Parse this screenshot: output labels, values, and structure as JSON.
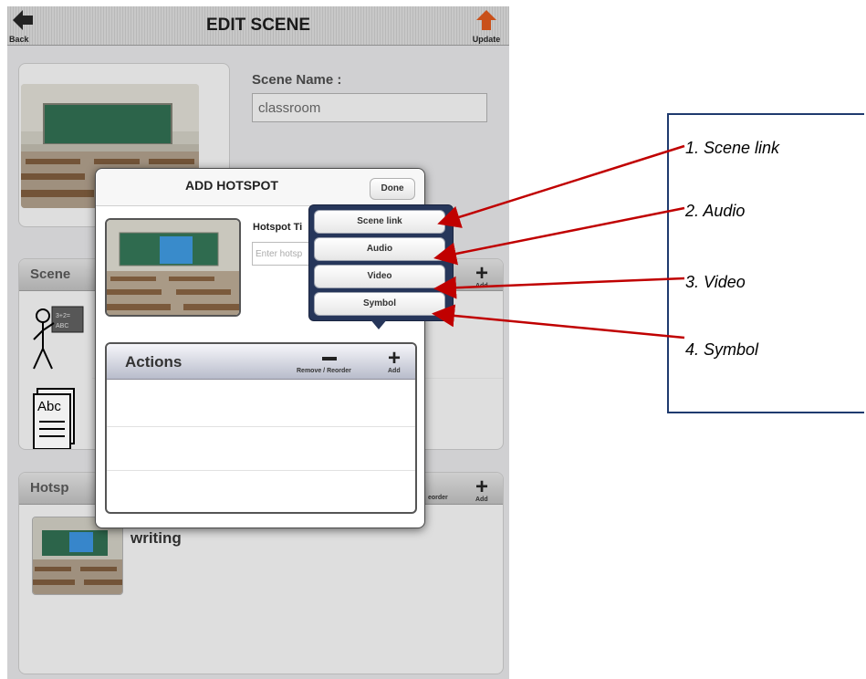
{
  "header": {
    "title": "EDIT SCENE",
    "back_label": "Back",
    "update_label": "Update"
  },
  "scene": {
    "name_label": "Scene Name :",
    "name_value": "classroom"
  },
  "scenes_section": {
    "title": "Scene",
    "add_label": "Add"
  },
  "hotspots_section": {
    "title": "Hotsp",
    "reorder_label": "eorder",
    "add_label": "Add",
    "items": [
      {
        "title": "writing"
      }
    ]
  },
  "modal": {
    "title": "ADD HOTSPOT",
    "done_label": "Done",
    "hotspot_title_label": "Hotspot Ti",
    "hotspot_title_placeholder": "Enter hotsp",
    "actions": {
      "title": "Actions",
      "remove_label": "Remove / Reorder",
      "add_label": "Add"
    }
  },
  "popover": {
    "items": [
      "Scene link",
      "Audio",
      "Video",
      "Symbol"
    ]
  },
  "callout": {
    "items": [
      "1. Scene link",
      "2. Audio",
      "3. Video",
      "4. Symbol"
    ]
  },
  "colors": {
    "arrow": "#c00000",
    "callout_border": "#1f3a6e",
    "popover_bg": "#26365a"
  },
  "icons": [
    "arrow-left-icon",
    "arrow-up-icon",
    "plus-icon",
    "minus-icon"
  ]
}
